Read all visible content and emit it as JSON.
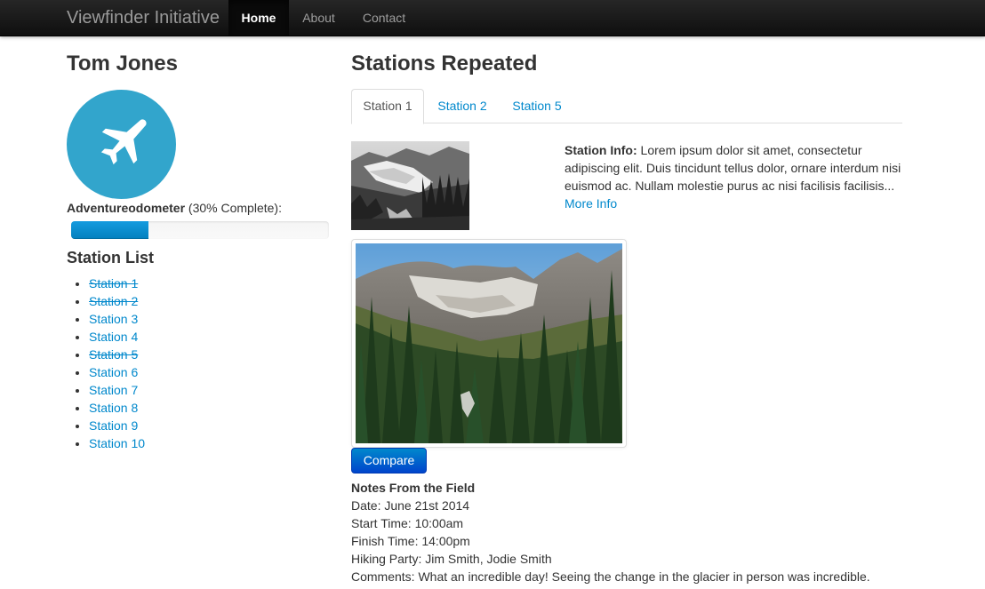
{
  "navbar": {
    "brand": "Viewfinder Initiative",
    "items": [
      "Home",
      "About",
      "Contact"
    ]
  },
  "sidebar": {
    "name": "Tom Jones",
    "avatar_icon": "airplane-icon",
    "odometer_label": "Adventureodometer",
    "odometer_status": "(30% Complete):",
    "progress": 0.3,
    "station_list_title": "Station List",
    "stations": [
      {
        "label": "Station 1",
        "visited": true
      },
      {
        "label": "Station 2",
        "visited": true
      },
      {
        "label": "Station 3",
        "visited": false
      },
      {
        "label": "Station 4",
        "visited": false
      },
      {
        "label": "Station 5",
        "visited": true
      },
      {
        "label": "Station 6",
        "visited": false
      },
      {
        "label": "Station 7",
        "visited": false
      },
      {
        "label": "Station 8",
        "visited": false
      },
      {
        "label": "Station 9",
        "visited": false
      },
      {
        "label": "Station 10",
        "visited": false
      }
    ]
  },
  "main": {
    "title": "Stations Repeated",
    "tabs": [
      "Station 1",
      "Station 2",
      "Station 5"
    ],
    "active_tab": "Station 1",
    "info_label": "Station Info:",
    "info_text": " Lorem ipsum dolor sit amet, consectetur adipiscing elit. Duis tincidunt tellus dolor, ornare interdum nisi euismod ac. Nullam molestie purus ac nisi facilisis facilisis... ",
    "more_link": "More Info",
    "compare_button": "Compare",
    "notes": {
      "title": "Notes From the Field",
      "date": "Date: June 21st 2014",
      "start": "Start Time: 10:00am",
      "finish": "Finish Time: 14:00pm",
      "party": "Hiking Party: Jim Smith, Jodie Smith",
      "comments": "Comments: What an incredible day! Seeing the change in the glacier in person was incredible."
    }
  },
  "colors": {
    "link": "#0088cc",
    "avatar_bg": "#32a5cc",
    "button": "#0044cc"
  }
}
